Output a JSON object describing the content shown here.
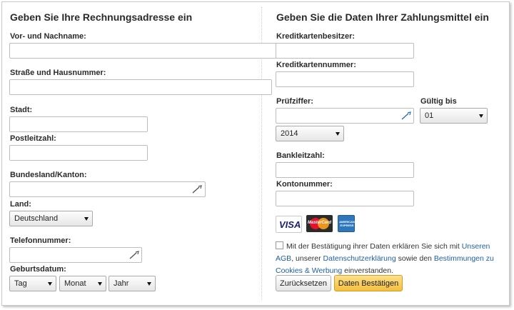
{
  "billing": {
    "heading": "Geben Sie Ihre Rechnungsadresse ein",
    "name_label": "Vor- und Nachname:",
    "street_label": "Straße und Hausnummer:",
    "city_label": "Stadt:",
    "zip_label": "Postleitzahl:",
    "state_label": "Bundesland/Kanton:",
    "country_label": "Land:",
    "country_value": "Deutschland",
    "phone_label": "Telefonnummer:",
    "birthdate_label": "Geburtsdatum:",
    "day_value": "Tag",
    "month_value": "Monat",
    "year_value": "Jahr"
  },
  "payment": {
    "heading": "Geben Sie die Daten Ihrer Zahlungsmittel ein",
    "cardholder_label": "Kreditkartenbesitzer:",
    "cardnumber_label": "Kreditkartennummer:",
    "cvc_label": "Prüfziffer:",
    "valid_label": "Gültig bis",
    "month_value": "01",
    "year_value": "2014",
    "bankcode_label": "Bankleitzahl:",
    "account_label": "Kontonummer:",
    "cards": {
      "visa": "VISA",
      "mastercard": "MasterCard",
      "amex": "AMERICAN EXPRESS"
    }
  },
  "terms": {
    "part1": "Mit der Bestätigung ihrer Daten erklären Sie sich mit ",
    "link_agb": "Unseren AGB",
    "part2": ", unserer ",
    "link_privacy": "Datenschutzerklärung",
    "part3": " sowie den ",
    "link_cookies": "Bestimmungen zu Cookies & Werbung",
    "part4": " einverstanden."
  },
  "buttons": {
    "reset": "Zurücksetzen",
    "confirm": "Daten Bestätigen"
  },
  "colors": {
    "link": "#1f5fa6",
    "confirm_button": "#f4bf3e",
    "visa_blue": "#1a1f71",
    "amex_blue": "#2e77bb"
  }
}
